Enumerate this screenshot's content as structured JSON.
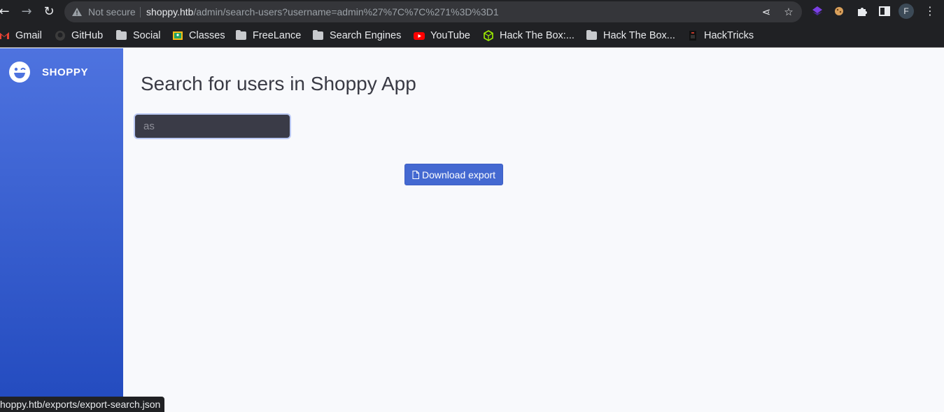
{
  "browser": {
    "not_secure_label": "Not secure",
    "url_host": "shoppy.htb",
    "url_path": "/admin/search-users?username=admin%27%7C%7C%271%3D%3D1",
    "profile_initial": "F"
  },
  "bookmarks": [
    {
      "label": "Gmail",
      "icon": "gmail-icon"
    },
    {
      "label": "GitHub",
      "icon": "github-icon"
    },
    {
      "label": "Social",
      "icon": "folder-icon"
    },
    {
      "label": "Classes",
      "icon": "classroom-icon"
    },
    {
      "label": "FreeLance",
      "icon": "folder-icon"
    },
    {
      "label": "Search Engines",
      "icon": "folder-icon"
    },
    {
      "label": "YouTube",
      "icon": "youtube-icon"
    },
    {
      "label": "Hack The Box:...",
      "icon": "hackthebox-icon"
    },
    {
      "label": "Hack The Box...",
      "icon": "folder-icon"
    },
    {
      "label": "HackTricks",
      "icon": "hacktricks-icon"
    }
  ],
  "sidebar": {
    "brand": "SHOPPY"
  },
  "main": {
    "title": "Search for users in Shoppy App",
    "search_placeholder": "as",
    "download_label": "Download export"
  },
  "status_bar": {
    "link": "hoppy.htb/exports/export-search.json"
  }
}
